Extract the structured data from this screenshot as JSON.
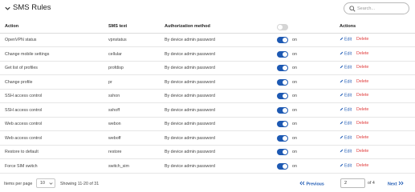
{
  "title": "SMS Rules",
  "search": {
    "placeholder": "Search..."
  },
  "columns": {
    "action": "Action",
    "sms_text": "SMS text",
    "auth": "Authorization method",
    "actions": "Actions"
  },
  "master_toggle": false,
  "row_labels": {
    "on": "on",
    "edit": "Edit",
    "delete": "Delete"
  },
  "rows": [
    {
      "action": "OpenVPN status",
      "sms_text": "vpnstatus",
      "auth": "By device admin password",
      "enabled": true
    },
    {
      "action": "Change mobile settings",
      "sms_text": "cellular",
      "auth": "By device admin password",
      "enabled": true
    },
    {
      "action": "Get list of profiles",
      "sms_text": "profdisp",
      "auth": "By device admin password",
      "enabled": true
    },
    {
      "action": "Change profile",
      "sms_text": "pr",
      "auth": "By device admin password",
      "enabled": true
    },
    {
      "action": "SSH access control",
      "sms_text": "sshon",
      "auth": "By device admin password",
      "enabled": true
    },
    {
      "action": "SSH access control",
      "sms_text": "sshoff",
      "auth": "By device admin password",
      "enabled": true
    },
    {
      "action": "Web access control",
      "sms_text": "webon",
      "auth": "By device admin password",
      "enabled": true
    },
    {
      "action": "Web access control",
      "sms_text": "weboff",
      "auth": "By device admin password",
      "enabled": true
    },
    {
      "action": "Restore to default",
      "sms_text": "restore",
      "auth": "By device admin password",
      "enabled": true
    },
    {
      "action": "Force SIM switch",
      "sms_text": "switch_sim",
      "auth": "By device admin password",
      "enabled": true
    }
  ],
  "footer": {
    "items_per_page_label": "Items per page",
    "items_per_page": "10",
    "showing": "Showing 11-20 of 31",
    "previous": "Previous",
    "page": "2",
    "of": "of 4",
    "next": "Next"
  },
  "colors": {
    "accent": "#1d59b3",
    "danger": "#e03b3b",
    "toggle_off": "#d5d5d5"
  },
  "icons": [
    "chevron-down-icon",
    "search-icon",
    "pencil-icon",
    "double-chevron-left-icon",
    "double-chevron-right-icon"
  ]
}
